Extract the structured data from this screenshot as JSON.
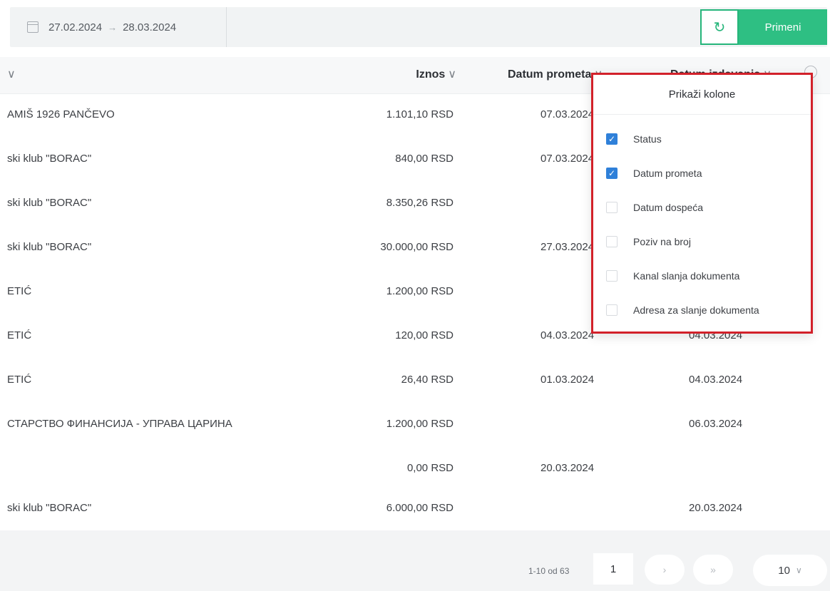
{
  "toolbar": {
    "date_from": "27.02.2024",
    "date_to": "28.03.2024",
    "date_separator": "→",
    "refresh_glyph": "↻",
    "apply_label": "Primeni"
  },
  "table": {
    "headers": {
      "first_chevron": "∨",
      "amount": "Iznos",
      "amount_chevron": "∨",
      "turnover_date": "Datum prometa",
      "turnover_chevron": "∨",
      "issue_date": "Datum izdavanja",
      "issue_chevron": "∨"
    },
    "rows": [
      {
        "name": "AMIŠ 1926 PANČEVO",
        "amount": "1.101,10 RSD",
        "turnover_date": "07.03.2024",
        "issue_date": ""
      },
      {
        "name": "ski klub \"BORAC\"",
        "amount": "840,00 RSD",
        "turnover_date": "07.03.2024",
        "issue_date": ""
      },
      {
        "name": "ski klub \"BORAC\"",
        "amount": "8.350,26 RSD",
        "turnover_date": "",
        "issue_date": ""
      },
      {
        "name": "ski klub \"BORAC\"",
        "amount": "30.000,00 RSD",
        "turnover_date": "27.03.2024",
        "issue_date": ""
      },
      {
        "name": "ETIĆ",
        "amount": "1.200,00 RSD",
        "turnover_date": "",
        "issue_date": ""
      },
      {
        "name": "ETIĆ",
        "amount": "120,00 RSD",
        "turnover_date": "04.03.2024",
        "issue_date": "04.03.2024"
      },
      {
        "name": "ETIĆ",
        "amount": "26,40 RSD",
        "turnover_date": "01.03.2024",
        "issue_date": "04.03.2024"
      },
      {
        "name": "СТАРСТВО ФИНАНСИЈА - УПРАВА ЦАРИНА",
        "amount": "1.200,00 RSD",
        "turnover_date": "",
        "issue_date": "06.03.2024"
      },
      {
        "name": "",
        "amount": "0,00 RSD",
        "turnover_date": "20.03.2024",
        "issue_date": ""
      },
      {
        "name": "ski klub \"BORAC\"",
        "amount": "6.000,00 RSD",
        "turnover_date": "",
        "issue_date": "20.03.2024"
      }
    ]
  },
  "pagination": {
    "range_text": "1-10 od 63",
    "current_page": "1",
    "next_glyph": "›",
    "last_glyph": "»",
    "per_page": "10",
    "per_page_chevron": "∨"
  },
  "column_popup": {
    "title": "Prikaži kolone",
    "check_glyph": "✓",
    "options": [
      {
        "label": "Status",
        "checked": true
      },
      {
        "label": "Datum prometa",
        "checked": true
      },
      {
        "label": "Datum dospeća",
        "checked": false
      },
      {
        "label": "Poziv na broj",
        "checked": false
      },
      {
        "label": "Kanal slanja dokumenta",
        "checked": false
      },
      {
        "label": "Adresa za slanje dokumenta",
        "checked": false
      }
    ]
  },
  "colors": {
    "accent_green": "#2ebf83",
    "popup_highlight": "#d2212a",
    "checkbox_blue": "#2f80d9"
  }
}
